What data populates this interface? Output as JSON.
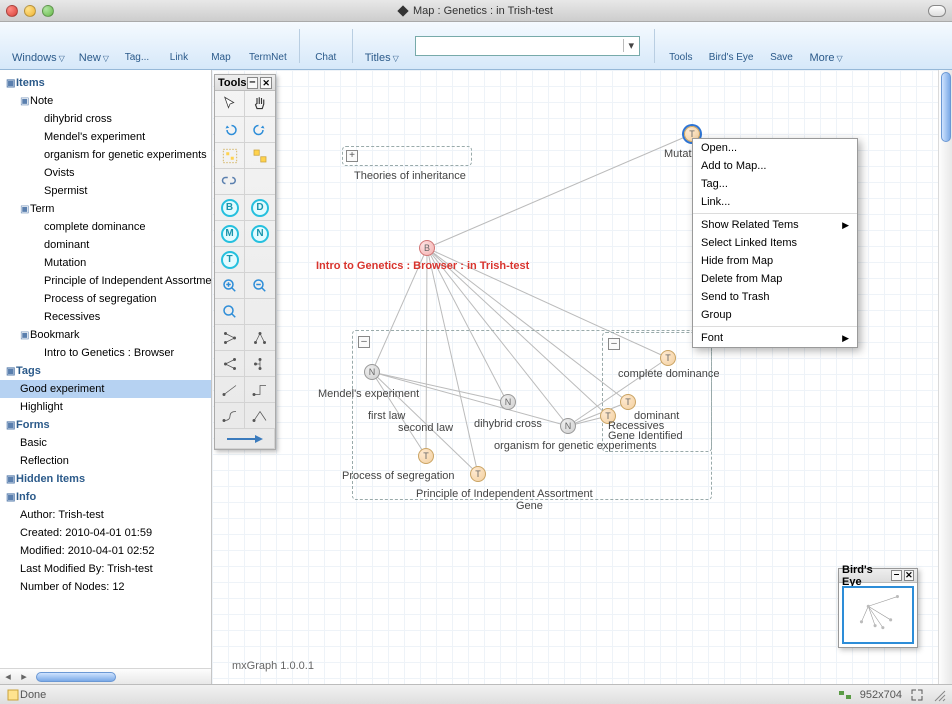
{
  "window_title": "Map : Genetics : in Trish-test",
  "toolbar": [
    {
      "label": "Windows",
      "dropdown": true,
      "icon": "windows"
    },
    {
      "label": "New",
      "dropdown": true,
      "icon": "new"
    },
    {
      "label": "Tag...",
      "icon": "tag"
    },
    {
      "label": "Link",
      "icon": "link"
    },
    {
      "label": "Map",
      "icon": "map"
    },
    {
      "label": "TermNet",
      "icon": "termnet"
    },
    {
      "label": "Chat",
      "icon": "chat"
    },
    {
      "label": "Titles",
      "dropdown": true,
      "icon": "titles"
    }
  ],
  "toolbar_right": [
    {
      "label": "Tools",
      "icon": "tools"
    },
    {
      "label": "Bird's Eye",
      "icon": "birdseye"
    },
    {
      "label": "Save",
      "icon": "save"
    },
    {
      "label": "More",
      "dropdown": true,
      "icon": "more"
    }
  ],
  "search_value": "",
  "sidebar": {
    "sections": [
      {
        "label": "Items",
        "children": [
          {
            "label": "Note",
            "children": [
              "dihybrid cross",
              "Mendel's experiment",
              "organism for genetic experiments",
              "Ovists",
              "Spermist"
            ]
          },
          {
            "label": "Term",
            "children": [
              "complete dominance",
              "dominant",
              "Mutation",
              "Principle of Independent Assortment",
              "Process of segregation",
              "Recessives"
            ]
          },
          {
            "label": "Bookmark",
            "children": [
              "Intro to Genetics : Browser"
            ]
          }
        ]
      },
      {
        "label": "Tags",
        "children": [
          {
            "label": "Good experiment",
            "selected": true
          },
          {
            "label": "Highlight"
          }
        ]
      },
      {
        "label": "Forms",
        "children": [
          {
            "label": "Basic"
          },
          {
            "label": "Reflection"
          }
        ]
      },
      {
        "label": "Hidden Items"
      },
      {
        "label": "Info",
        "children": [
          {
            "label": "Author: Trish-test"
          },
          {
            "label": "Created: 2010-04-01 01:59"
          },
          {
            "label": "Modified: 2010-04-01 02:52"
          },
          {
            "label": "Last Modified By: Trish-test"
          },
          {
            "label": "Number of Nodes: 12"
          }
        ]
      }
    ]
  },
  "canvas": {
    "browser_label": "Intro to Genetics : Browser : in Trish-test",
    "labels": {
      "theories": "Theories of inheritance",
      "mutation": "Mutation",
      "mendel": "Mendel's experiment",
      "firstlaw": "first law",
      "secondlaw": "second law",
      "process": "Process of segregation",
      "principle": "Principle of Independent Assortment",
      "dihybrid": "dihybrid cross",
      "organism": "organism for genetic experiments",
      "gene": "Gene",
      "geneid": "Gene Identified",
      "complete": "complete dominance",
      "dominant": "dominant",
      "recessives": "Recessives"
    },
    "version": "mxGraph 1.0.0.1"
  },
  "palette_title": "Tools",
  "birdseye_title": "Bird's Eye",
  "context_menu": [
    "Open...",
    "Add to Map...",
    "Tag...",
    "Link...",
    {
      "label": "Show Related Tems",
      "sub": true
    },
    "Select Linked Items",
    "Hide from Map",
    "Delete from Map",
    "Send to Trash",
    "Group",
    {
      "label": "Font",
      "sub": true
    }
  ],
  "status": {
    "left": "Done",
    "dims": "952x704"
  }
}
